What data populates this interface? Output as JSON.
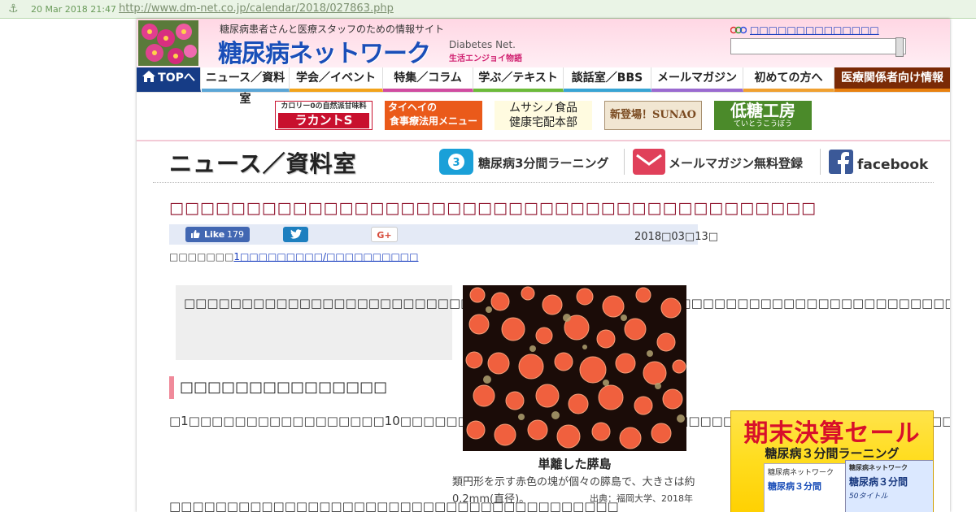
{
  "archive_bar": {
    "timestamp": "20 Mar 2018 21:47",
    "url": "http://www.dm-net.co.jp/calendar/2018/027863.php"
  },
  "header": {
    "tagline": "糖尿病患者さんと医療スタッフのための情報サイト",
    "title": "糖尿病ネットワーク",
    "subtitle_en": "Diabetes Net.",
    "subtitle_jp": "生活エンジョイ物語",
    "partner_link": "□□□□□□□□□□□□□□",
    "search_placeholder": ""
  },
  "nav": {
    "items": [
      {
        "label": "TOPへ",
        "color": "#163c86"
      },
      {
        "label": "ニュース／資料室",
        "color": "#5ba6d6"
      },
      {
        "label": "学会／イベント",
        "color": "#f2a31b"
      },
      {
        "label": "特集／コラム",
        "color": "#d04ba0"
      },
      {
        "label": "学ぶ／テキスト",
        "color": "#6cba3a"
      },
      {
        "label": "談話室／BBS",
        "color": "#38a4d4"
      },
      {
        "label": "メールマガジン",
        "color": "#9a6ad0"
      },
      {
        "label": "初めての方へ",
        "color": "#f0a030"
      },
      {
        "label": "医療関係者向け情報",
        "color": "#e88010"
      }
    ]
  },
  "banners": {
    "lakanto_top": "カロリー0の自然派甘味料",
    "lakanto_main": "ラカントS",
    "taihei_top": "タイヘイの",
    "taihei_main": "食事療法用メニュー",
    "musashino_line1": "ムサシノ食品",
    "musashino_line2": "健康宅配本部",
    "sunao_main": "新登場！SUNAO",
    "teitou_main": "低糖工房",
    "teitou_sub": "ていとうこうぼう"
  },
  "section": {
    "title": "ニュース／資料室",
    "learning_link": "糖尿病3分間ラーニング",
    "magazine_link": "メールマガジン無料登録",
    "facebook_link": "facebook"
  },
  "article": {
    "title": "□□□□□□□□□□□□□□□□□□□□□□□□□□□□□□□□□□□□□□□□□□",
    "like_label": "Like",
    "like_count": "179",
    "gplus_label": "G+",
    "date": "2018□03□13□",
    "category_prefix": "□□□□□□□",
    "category_link": "1□□□□□□□□□/□□□□□□□□□□",
    "summary": "□□□□□□□□□□□□□□□□□□□□□□□□□□□□□□□□□□□□□□□□□□□□□□□□□□□□□□□□□□□□□□□□□□□□□□□□□□□□□□□□",
    "subheading": "□□□□□□□□□□□□□□□",
    "paragraph1": "□1□□□□□□□□□□□□□□□□□10□□□□□□1□2□□□□□□□□1□□□□□□□□□□□□□□□□□□□□□□□□□□□□□□□□□□□□□□□□□□□□□□□□□□□□□□□□□□□□□□□99□□□□□□2□□□□□□□□□□□□□□□□□□□□□□□",
    "paragraph2": "□□□□□□□□□□□□□□□□□□□□□□□□□□□□□□□□□□□□□□□",
    "photo_title": "単離した膵島",
    "photo_caption": "類円形を示す赤色の塊が個々の膵島で、大きさは約0.2mm(直径)。",
    "photo_credit": "出典：福岡大学、2018年"
  },
  "ad": {
    "headline": "期末決算セール",
    "sub": "糖尿病３分間ラーニング",
    "box_label": "糖尿病ネットワーク",
    "box_title": "糖尿病３分間",
    "box_note": "50タイトル"
  }
}
